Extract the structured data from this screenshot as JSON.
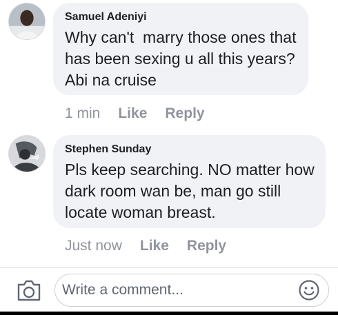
{
  "comments": [
    {
      "author": "Samuel Adeniyi",
      "text": "Why can't  marry those ones that has been sexing u all this years? Abi na cruise",
      "time": "1 min",
      "like_label": "Like",
      "reply_label": "Reply"
    },
    {
      "author": "Stephen Sunday",
      "text": "Pls keep searching. NO matter how dark room wan be, man go still locate woman breast.",
      "time": "Just now",
      "like_label": "Like",
      "reply_label": "Reply"
    }
  ],
  "composer": {
    "placeholder": "Write a comment...",
    "camera_icon": "camera-icon",
    "emoji_icon": "emoji-icon"
  },
  "colors": {
    "bubble_bg": "#f0f2f5",
    "meta_text": "#90949c",
    "divider": "#dadde1"
  }
}
